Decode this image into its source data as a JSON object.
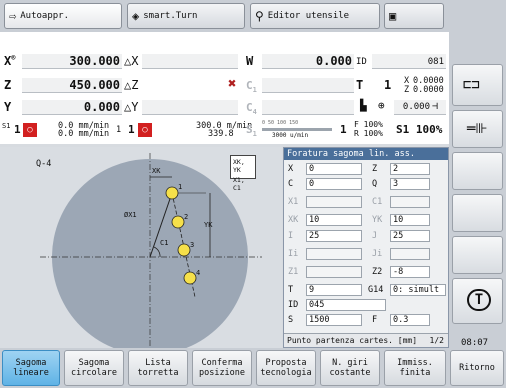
{
  "tabs": [
    {
      "label": "Autoappr.",
      "icon": "arrow-right-icon"
    },
    {
      "label": "smart.Turn",
      "icon": "diamond-arrows-icon"
    },
    {
      "label": "Editor utensile",
      "icon": "tool-icon"
    },
    {
      "label": "",
      "icon": "save-icon"
    }
  ],
  "status": {
    "x_axis": "X",
    "x_sup": "®",
    "x_val": "300.000",
    "x_delta": "△X",
    "z_axis": "Z",
    "z_val": "450.000",
    "z_delta": "△Z",
    "y_axis": "Y",
    "y_val": "0.000",
    "y_delta": "△Y",
    "w_axis": "W",
    "w_val": "0.000",
    "id_label": "ID",
    "id_val": "081",
    "c1_label": "C",
    "c1_sub": "1",
    "c4_label": "C",
    "c4_sub": "4",
    "t_label": "T",
    "t_val": "1",
    "tx_val": "0.0000",
    "tz_val": "0.0000",
    "tx_label": "X",
    "tz_label": "Z",
    "pos_val": "0.000",
    "s1_label": "S1",
    "s1_num": "1",
    "feed1": "0.0 mm/min",
    "feed2": "0.0 mm/min",
    "s_one": "1",
    "feed3": "300.0 m/min",
    "feed4": "339.8",
    "s_label": "S",
    "s_sub": "1",
    "scale_ticks": "0 50 100 150",
    "rpm": "3000 u/min",
    "g_num": "1",
    "f_pct": "F 100%",
    "r_pct": "R 100%",
    "s1_pct": "S1 100%"
  },
  "graphic": {
    "q_label": "Q-4",
    "xk_label": "XK",
    "yk_label": "YK",
    "dx1_label": "ØX1",
    "c1_label": "C1",
    "num1": "1",
    "num2": "2",
    "num3": "3",
    "num4": "4",
    "btn1": "XK, YK",
    "btn2": "X1, C1"
  },
  "dialog": {
    "title": "Foratura sagoma lin. ass.",
    "fields": [
      {
        "l": "X",
        "v": "0",
        "l2": "Z",
        "v2": "2"
      },
      {
        "l": "C",
        "v": "0",
        "l2": "Q",
        "v2": "3"
      },
      {
        "l": "X1",
        "v": "",
        "l2": "C1",
        "v2": ""
      },
      {
        "l": "XK",
        "v": "10",
        "l2": "YK",
        "v2": "10"
      },
      {
        "l": "I",
        "v": "25",
        "l2": "J",
        "v2": "25"
      },
      {
        "l": "Ii",
        "v": "",
        "l2": "Ji",
        "v2": ""
      },
      {
        "l": "Z1",
        "v": "",
        "l2": "Z2",
        "v2": "-8"
      },
      {
        "l": "T",
        "v": "9",
        "l2": "G14",
        "v2": "0: simult"
      },
      {
        "l": "ID",
        "v": "045"
      },
      {
        "l": "S",
        "v": "1500",
        "l2": "F",
        "v2": "0.3"
      }
    ],
    "hint": "Punto partenza cartes. [mm]",
    "page": "1/2"
  },
  "time": "08:07",
  "softkeys": [
    "Sagoma\nlineare",
    "Sagoma\ncircolare",
    "Lista\ntorretta",
    "Conferma\nposizione",
    "Proposta\ntecnologia",
    "N. giri\ncostante",
    "Immiss.\nfinita",
    "Ritorno"
  ],
  "colors": {
    "accent": "#5fb3e6",
    "titlebar": "#4a6f9a",
    "danger": "#d22020",
    "hole": "#f6e04a"
  }
}
